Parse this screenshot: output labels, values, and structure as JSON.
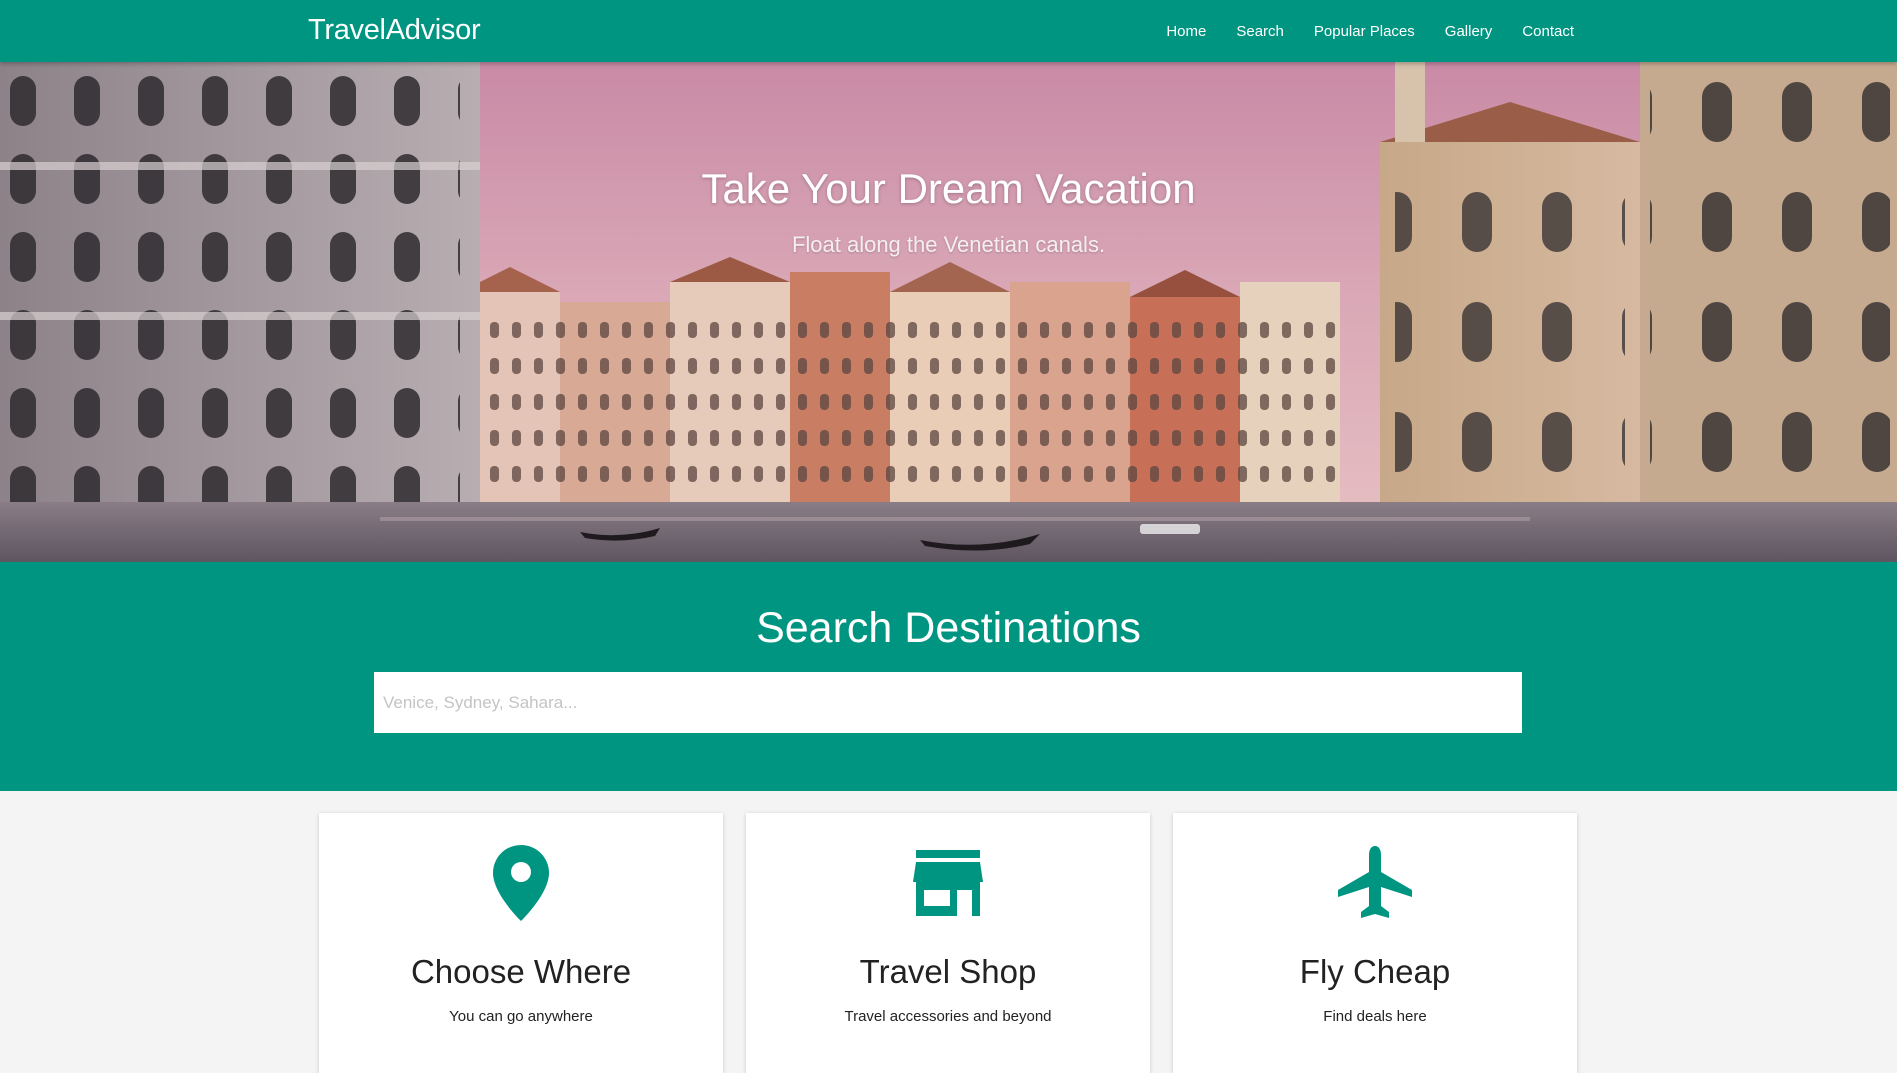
{
  "brand": "TravelAdvisor",
  "colors": {
    "primary": "#009581",
    "card_background": "#ffffff",
    "page_background": "#f4f4f4"
  },
  "nav": {
    "items": [
      {
        "label": "Home"
      },
      {
        "label": "Search"
      },
      {
        "label": "Popular Places"
      },
      {
        "label": "Gallery"
      },
      {
        "label": "Contact"
      }
    ]
  },
  "hero": {
    "title": "Take Your Dream Vacation",
    "subtitle": "Float along the Venetian canals.",
    "image_subject": "venice-grand-canal-photo"
  },
  "search": {
    "title": "Search Destinations",
    "placeholder": "Venice, Sydney, Sahara...",
    "value": ""
  },
  "features": [
    {
      "icon": "map-pin-icon",
      "title": "Choose Where",
      "text": "You can go anywhere"
    },
    {
      "icon": "storefront-icon",
      "title": "Travel Shop",
      "text": "Travel accessories and beyond"
    },
    {
      "icon": "airplane-icon",
      "title": "Fly Cheap",
      "text": "Find deals here"
    }
  ]
}
